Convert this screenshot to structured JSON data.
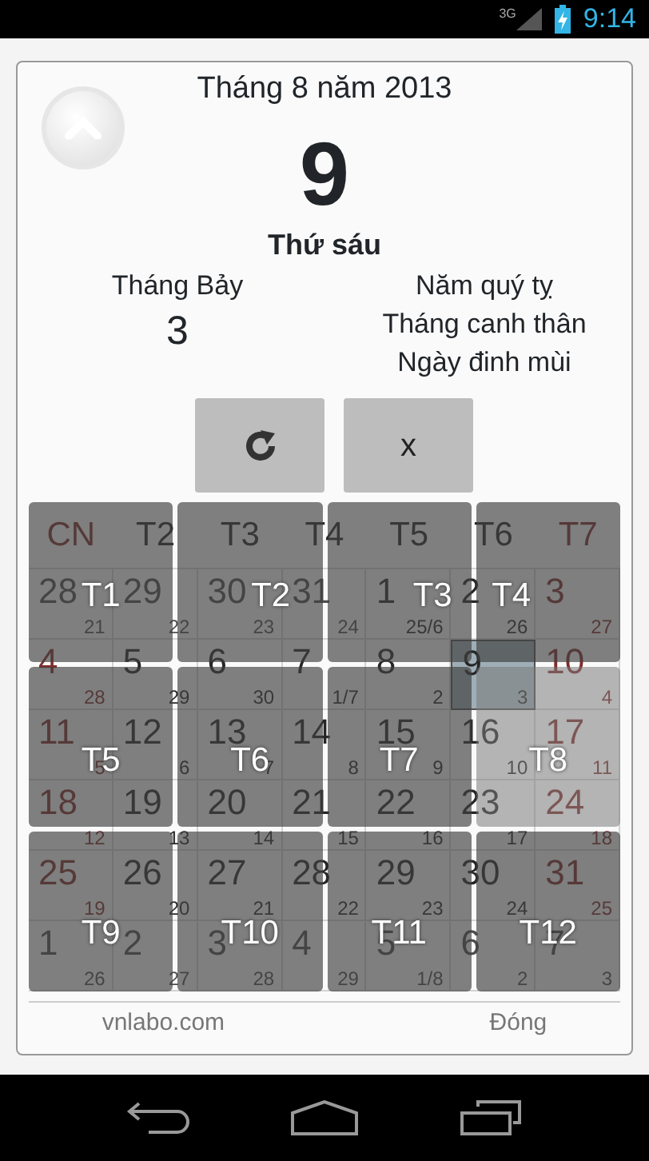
{
  "status_bar": {
    "network": "3G",
    "time": "9:14"
  },
  "header": {
    "month_year": "Tháng 8 năm 2013",
    "day": "9",
    "weekday": "Thứ sáu",
    "lunar_month": "Tháng Bảy",
    "lunar_day": "3",
    "can_chi": [
      "Năm quý tỵ",
      "Tháng canh thân",
      "Ngày đinh mùi"
    ]
  },
  "buttons": [
    {
      "kind": "refresh"
    },
    {
      "kind": "text",
      "label": "x"
    }
  ],
  "calendar": {
    "weekdays": [
      {
        "label": "CN",
        "weekend": true
      },
      {
        "label": "T2",
        "weekend": false
      },
      {
        "label": "T3",
        "weekend": false
      },
      {
        "label": "T4",
        "weekend": false
      },
      {
        "label": "T5",
        "weekend": false
      },
      {
        "label": "T6",
        "weekend": false
      },
      {
        "label": "T7",
        "weekend": true
      }
    ],
    "days": [
      {
        "day": "28",
        "lunar": "21",
        "other_month": true,
        "selected": false
      },
      {
        "day": "29",
        "lunar": "22",
        "other_month": true,
        "selected": false
      },
      {
        "day": "30",
        "lunar": "23",
        "other_month": true,
        "selected": false
      },
      {
        "day": "31",
        "lunar": "24",
        "other_month": true,
        "selected": false
      },
      {
        "day": "1",
        "lunar": "25/6",
        "other_month": false,
        "selected": false
      },
      {
        "day": "2",
        "lunar": "26",
        "other_month": false,
        "selected": false
      },
      {
        "day": "3",
        "lunar": "27",
        "other_month": false,
        "selected": false
      },
      {
        "day": "4",
        "lunar": "28",
        "other_month": false,
        "selected": false
      },
      {
        "day": "5",
        "lunar": "29",
        "other_month": false,
        "selected": false
      },
      {
        "day": "6",
        "lunar": "30",
        "other_month": false,
        "selected": false
      },
      {
        "day": "7",
        "lunar": "1/7",
        "other_month": false,
        "selected": false
      },
      {
        "day": "8",
        "lunar": "2",
        "other_month": false,
        "selected": false
      },
      {
        "day": "9",
        "lunar": "3",
        "other_month": false,
        "selected": true
      },
      {
        "day": "10",
        "lunar": "4",
        "other_month": false,
        "selected": false
      },
      {
        "day": "11",
        "lunar": "5",
        "other_month": false,
        "selected": false
      },
      {
        "day": "12",
        "lunar": "6",
        "other_month": false,
        "selected": false
      },
      {
        "day": "13",
        "lunar": "7",
        "other_month": false,
        "selected": false
      },
      {
        "day": "14",
        "lunar": "8",
        "other_month": false,
        "selected": false
      },
      {
        "day": "15",
        "lunar": "9",
        "other_month": false,
        "selected": false
      },
      {
        "day": "16",
        "lunar": "10",
        "other_month": false,
        "selected": false
      },
      {
        "day": "17",
        "lunar": "11",
        "other_month": false,
        "selected": false
      },
      {
        "day": "18",
        "lunar": "12",
        "other_month": false,
        "selected": false
      },
      {
        "day": "19",
        "lunar": "13",
        "other_month": false,
        "selected": false
      },
      {
        "day": "20",
        "lunar": "14",
        "other_month": false,
        "selected": false
      },
      {
        "day": "21",
        "lunar": "15",
        "other_month": false,
        "selected": false
      },
      {
        "day": "22",
        "lunar": "16",
        "other_month": false,
        "selected": false
      },
      {
        "day": "23",
        "lunar": "17",
        "other_month": false,
        "selected": false
      },
      {
        "day": "24",
        "lunar": "18",
        "other_month": false,
        "selected": false
      },
      {
        "day": "25",
        "lunar": "19",
        "other_month": false,
        "selected": false
      },
      {
        "day": "26",
        "lunar": "20",
        "other_month": false,
        "selected": false
      },
      {
        "day": "27",
        "lunar": "21",
        "other_month": false,
        "selected": false
      },
      {
        "day": "28",
        "lunar": "22",
        "other_month": false,
        "selected": false
      },
      {
        "day": "29",
        "lunar": "23",
        "other_month": false,
        "selected": false
      },
      {
        "day": "30",
        "lunar": "24",
        "other_month": false,
        "selected": false
      },
      {
        "day": "31",
        "lunar": "25",
        "other_month": false,
        "selected": false
      },
      {
        "day": "1",
        "lunar": "26",
        "other_month": true,
        "selected": false
      },
      {
        "day": "2",
        "lunar": "27",
        "other_month": true,
        "selected": false
      },
      {
        "day": "3",
        "lunar": "28",
        "other_month": true,
        "selected": false
      },
      {
        "day": "4",
        "lunar": "29",
        "other_month": true,
        "selected": false
      },
      {
        "day": "5",
        "lunar": "1/8",
        "other_month": true,
        "selected": false
      },
      {
        "day": "6",
        "lunar": "2",
        "other_month": true,
        "selected": false
      },
      {
        "day": "7",
        "lunar": "3",
        "other_month": true,
        "selected": false
      }
    ]
  },
  "month_picker": [
    {
      "label": "T1",
      "selected": false
    },
    {
      "label": "T2",
      "selected": false
    },
    {
      "label": "T3",
      "selected": false
    },
    {
      "label": "T4",
      "selected": false
    },
    {
      "label": "T5",
      "selected": false
    },
    {
      "label": "T6",
      "selected": false
    },
    {
      "label": "T7",
      "selected": false
    },
    {
      "label": "T8",
      "selected": true
    },
    {
      "label": "T9",
      "selected": false
    },
    {
      "label": "T10",
      "selected": false
    },
    {
      "label": "T11",
      "selected": false
    },
    {
      "label": "T12",
      "selected": false
    }
  ],
  "footer": {
    "site": "vnlabo.com",
    "close": "Đóng"
  }
}
